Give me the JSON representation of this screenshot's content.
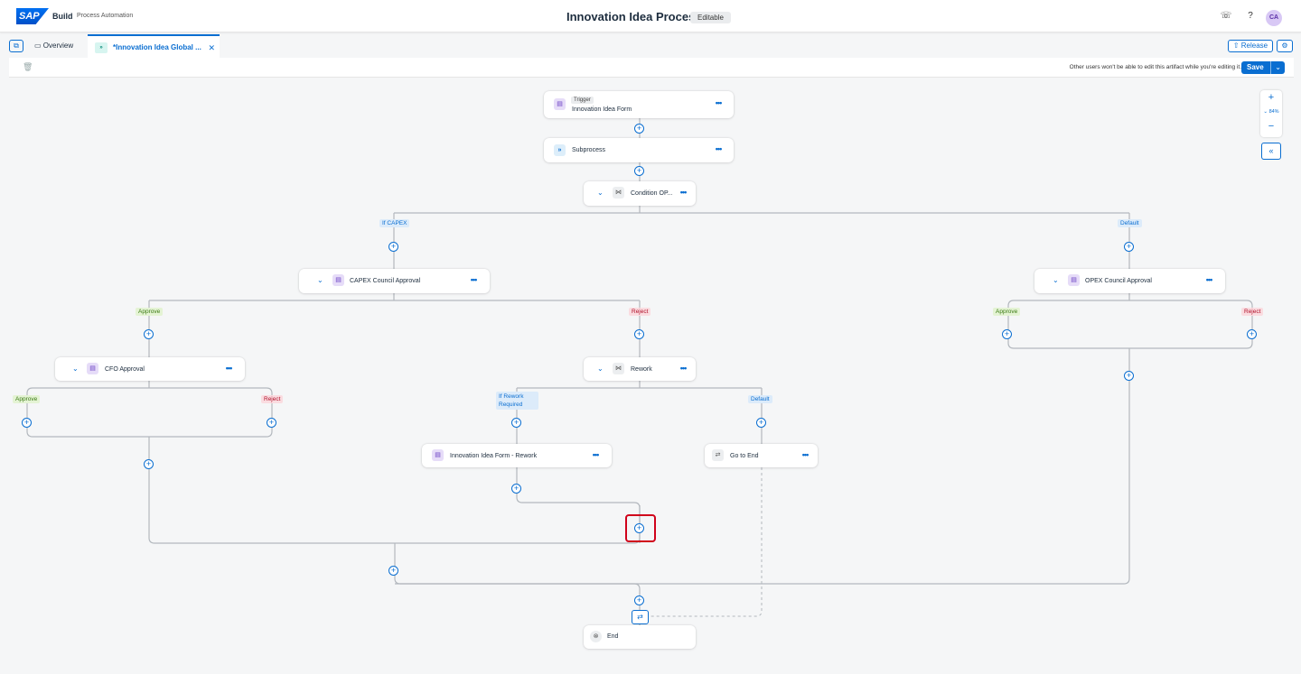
{
  "shell": {
    "logo": "SAP",
    "brand": "Build",
    "brand_sub": "Process Automation",
    "title": "Innovation Idea Process",
    "status_badge": "Editable",
    "user_initials": "CA"
  },
  "tabs": {
    "overview": "Overview",
    "active": "*Innovation Idea Global ...",
    "release": "Release"
  },
  "toolbar": {
    "hint": "Other users won't be able to edit this artifact while you're editing it.",
    "save": "Save"
  },
  "zoom": {
    "level": "84%"
  },
  "nodes": {
    "trigger_tag": "Trigger",
    "trigger": "Innovation Idea Form",
    "subprocess": "Subprocess",
    "condition": "Condition OP...",
    "capex": "CAPEX Council Approval",
    "opex": "OPEX Council Approval",
    "cfo": "CFO Approval",
    "rework": "Rework",
    "rework_form": "Innovation Idea Form - Rework",
    "goto_end": "Go to End",
    "end": "End"
  },
  "labels": {
    "if_capex": "If CAPEX",
    "default1": "Default",
    "approve1": "Approve",
    "reject1": "Reject",
    "approve2": "Approve",
    "reject2": "Reject",
    "approve3": "Approve",
    "reject3": "Reject",
    "if_rework_1": "If Rework",
    "if_rework_2": "Required",
    "default2": "Default"
  },
  "colors": {
    "accent": "#0a6ed1",
    "highlight": "#d0021b"
  }
}
